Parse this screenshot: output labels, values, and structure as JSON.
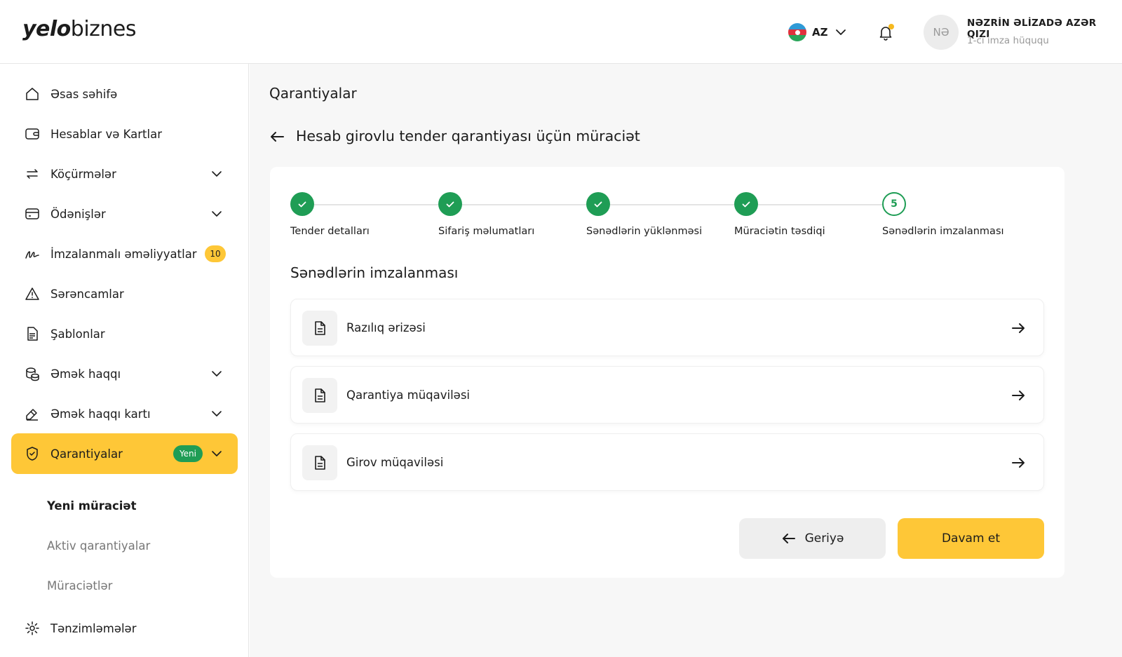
{
  "brand": {
    "logo_bold": "yelo",
    "logo_regular": "biznes",
    "accent": "#fec737",
    "success": "#1f9d55"
  },
  "header": {
    "language": "AZ",
    "avatar_initials": "NƏ",
    "user_name": "NƏZRİN ƏLİZADƏ AZƏR QIZI",
    "user_role": "1-ci imza hüququ"
  },
  "sidebar": {
    "items": [
      {
        "label": "Əsas səhifə",
        "icon": "home-icon"
      },
      {
        "label": "Hesablar və Kartlar",
        "icon": "wallet-icon"
      },
      {
        "label": "Köçürmələr",
        "icon": "transfer-icon",
        "expandable": true
      },
      {
        "label": "Ödənişlər",
        "icon": "card-icon",
        "expandable": true
      },
      {
        "label": "İmzalanmalı əməliyyatlar",
        "icon": "signature-icon",
        "badge": "10"
      },
      {
        "label": "Sərəncamlar",
        "icon": "warning-icon"
      },
      {
        "label": "Şablonlar",
        "icon": "template-icon"
      },
      {
        "label": "Əmək haqqı",
        "icon": "coins-icon",
        "expandable": true
      },
      {
        "label": "Əmək haqqı kartı",
        "icon": "salary-card-icon",
        "expandable": true
      },
      {
        "label": "Qarantiyalar",
        "icon": "shield-icon",
        "expandable": true,
        "active": true,
        "badge": "Yeni"
      },
      {
        "label": "Tənzimləmələr",
        "icon": "gear-icon"
      }
    ],
    "subitems": [
      {
        "label": "Yeni müraciət",
        "current": true
      },
      {
        "label": "Aktiv qarantiyalar"
      },
      {
        "label": "Müraciətlər"
      }
    ]
  },
  "main": {
    "page_title": "Qarantiyalar",
    "subtitle": "Hesab girovlu tender qarantiyası üçün müraciət",
    "steps": [
      {
        "label": "Tender detalları",
        "status": "done"
      },
      {
        "label": "Sifariş məlumatları",
        "status": "done"
      },
      {
        "label": "Sənədlərin yüklənməsi",
        "status": "done"
      },
      {
        "label": "Müraciətin təsdiqi",
        "status": "done"
      },
      {
        "label": "Sənədlərin imzalanması",
        "status": "current",
        "number": "5"
      }
    ],
    "section_title": "Sənədlərin imzalanması",
    "documents": [
      {
        "label": "Razılıq ərizəsi"
      },
      {
        "label": "Qarantiya müqaviləsi"
      },
      {
        "label": "Girov müqaviləsi"
      }
    ],
    "back_button": "Geriyə",
    "next_button": "Davam et"
  }
}
